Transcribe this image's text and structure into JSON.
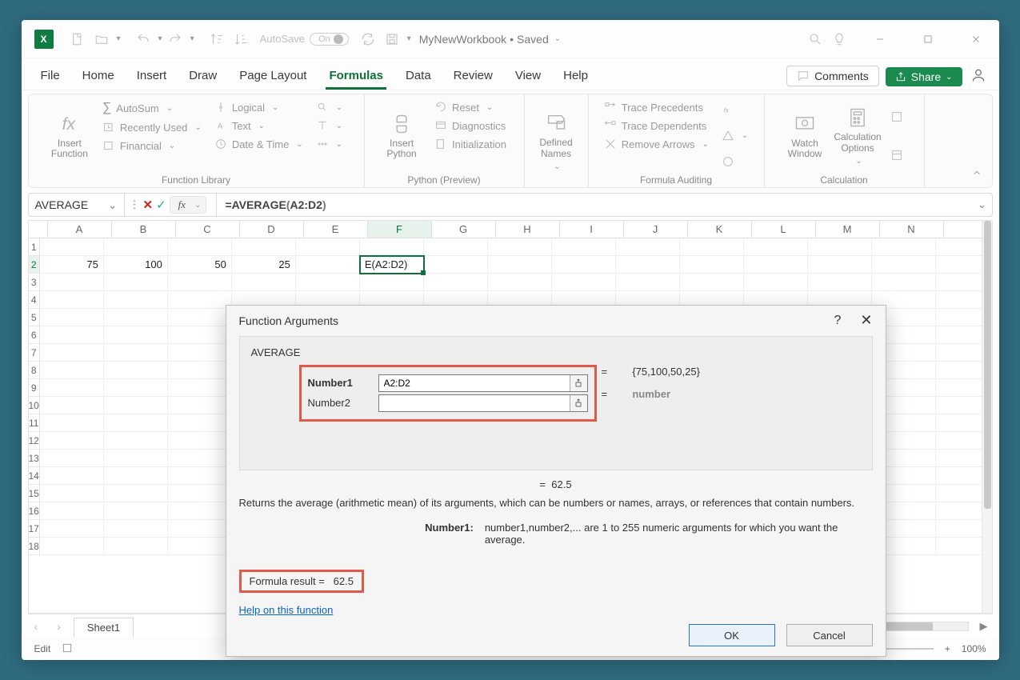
{
  "titlebar": {
    "app_icon_label": "X",
    "autosave_label": "AutoSave",
    "autosave_state": "On",
    "doc_name": "MyNewWorkbook",
    "doc_state": "Saved"
  },
  "tabs": {
    "items": [
      "File",
      "Home",
      "Insert",
      "Draw",
      "Page Layout",
      "Formulas",
      "Data",
      "Review",
      "View",
      "Help"
    ],
    "active_index": 5,
    "comments_label": "Comments",
    "share_label": "Share"
  },
  "ribbon": {
    "groups": {
      "function_library": {
        "label": "Function Library",
        "insert_function": "Insert Function",
        "autosum": "AutoSum",
        "recently_used": "Recently Used",
        "financial": "Financial",
        "logical": "Logical",
        "text": "Text",
        "date_time": "Date & Time"
      },
      "python": {
        "label": "Python (Preview)",
        "insert_python": "Insert Python",
        "reset": "Reset",
        "diagnostics": "Diagnostics",
        "initialization": "Initialization"
      },
      "defined_names": {
        "label": "",
        "defined_names": "Defined Names"
      },
      "formula_auditing": {
        "label": "Formula Auditing",
        "trace_precedents": "Trace Precedents",
        "trace_dependents": "Trace Dependents",
        "remove_arrows": "Remove Arrows"
      },
      "calculation": {
        "label": "Calculation",
        "watch_window": "Watch Window",
        "calc_options": "Calculation Options"
      }
    }
  },
  "formula_bar": {
    "name_box": "AVERAGE",
    "formula_fn": "=AVERAGE",
    "formula_open": "(",
    "formula_arg": "A2:D2",
    "formula_close": ")"
  },
  "grid": {
    "columns": [
      "A",
      "B",
      "C",
      "D",
      "E",
      "F",
      "G",
      "H",
      "I",
      "J",
      "K",
      "L",
      "M",
      "N"
    ],
    "active_col_index": 5,
    "active_row_index": 1,
    "rows_visible": 18,
    "data": {
      "row2": {
        "A": "75",
        "B": "100",
        "C": "50",
        "D": "25",
        "F": "E(A2:D2)"
      }
    }
  },
  "sheet": {
    "tabs": [
      "Sheet1"
    ]
  },
  "statusbar": {
    "mode": "Edit",
    "zoom": "100%"
  },
  "dialog": {
    "title": "Function Arguments",
    "fn_name": "AVERAGE",
    "args": [
      {
        "label": "Number1",
        "value": "A2:D2",
        "result": "{75,100,50,25}",
        "bold": true
      },
      {
        "label": "Number2",
        "value": "",
        "result": "number",
        "bold": false
      }
    ],
    "eq": "=",
    "intermediate_result": "62.5",
    "description": "Returns the average (arithmetic mean) of its arguments, which can be numbers or names, arrays, or references that contain numbers.",
    "arg_desc_key": "Number1:",
    "arg_desc_val": "number1,number2,... are 1 to 255 numeric arguments for which you want the average.",
    "formula_result_label": "Formula result  =",
    "formula_result_value": "62.5",
    "help_link": "Help on this function",
    "ok": "OK",
    "cancel": "Cancel"
  }
}
